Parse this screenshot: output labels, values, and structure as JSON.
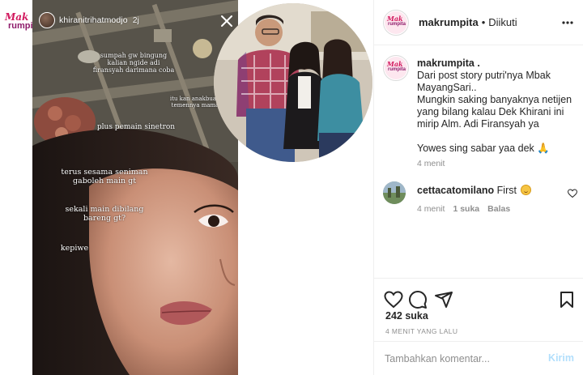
{
  "post_image": {
    "watermark": {
      "line1": "Mak",
      "line2": "rumpita"
    },
    "story": {
      "username": "khiranitrihatmodjo",
      "time": "2j",
      "texts": {
        "t1": "sumpah gw bingung\nkalian ngide adi\nfiransyah darimana coba",
        "t2": "itu kan anakbuahnya\ntemennya mamah??",
        "t3": "plus pemain sinetron",
        "t4": "terus sesama seniman\ngaboleh main gt",
        "t5": "sekali main dibilang\nbareng gt?",
        "t6": "kepiwe"
      }
    }
  },
  "header": {
    "avatar_line1": "Mak",
    "avatar_line2": "rumpita",
    "username": "makrumpita",
    "separator": "•",
    "follow_status": "Diikuti"
  },
  "caption": {
    "username": "makrumpita .",
    "text": "Dari post story putri'nya Mbak MayangSari..\nMungkin saking banyaknya netijen yang bilang kalau Dek Khirani ini mirip Alm. Adi Firansyah ya\n\nYowes sing sabar yaa dek",
    "emoji": "🙏",
    "time": "4 menit"
  },
  "comment": {
    "username": "cettacatomilano",
    "text": "First",
    "time": "4 menit",
    "likes": "1 suka",
    "reply": "Balas"
  },
  "actions": {
    "icons": [
      "heart-icon",
      "comment-icon",
      "share-icon",
      "bookmark-icon"
    ]
  },
  "likes": "242 suka",
  "post_time": "4 MENIT YANG LALU",
  "comment_box": {
    "placeholder": "Tambahkan komentar...",
    "post_label": "Kirim"
  },
  "colors": {
    "brand_pink": "#d21a5f",
    "brand_purple": "#8e1b6a",
    "post_button_disabled": "#b2dffc",
    "muted_text": "#8e8e8e"
  }
}
